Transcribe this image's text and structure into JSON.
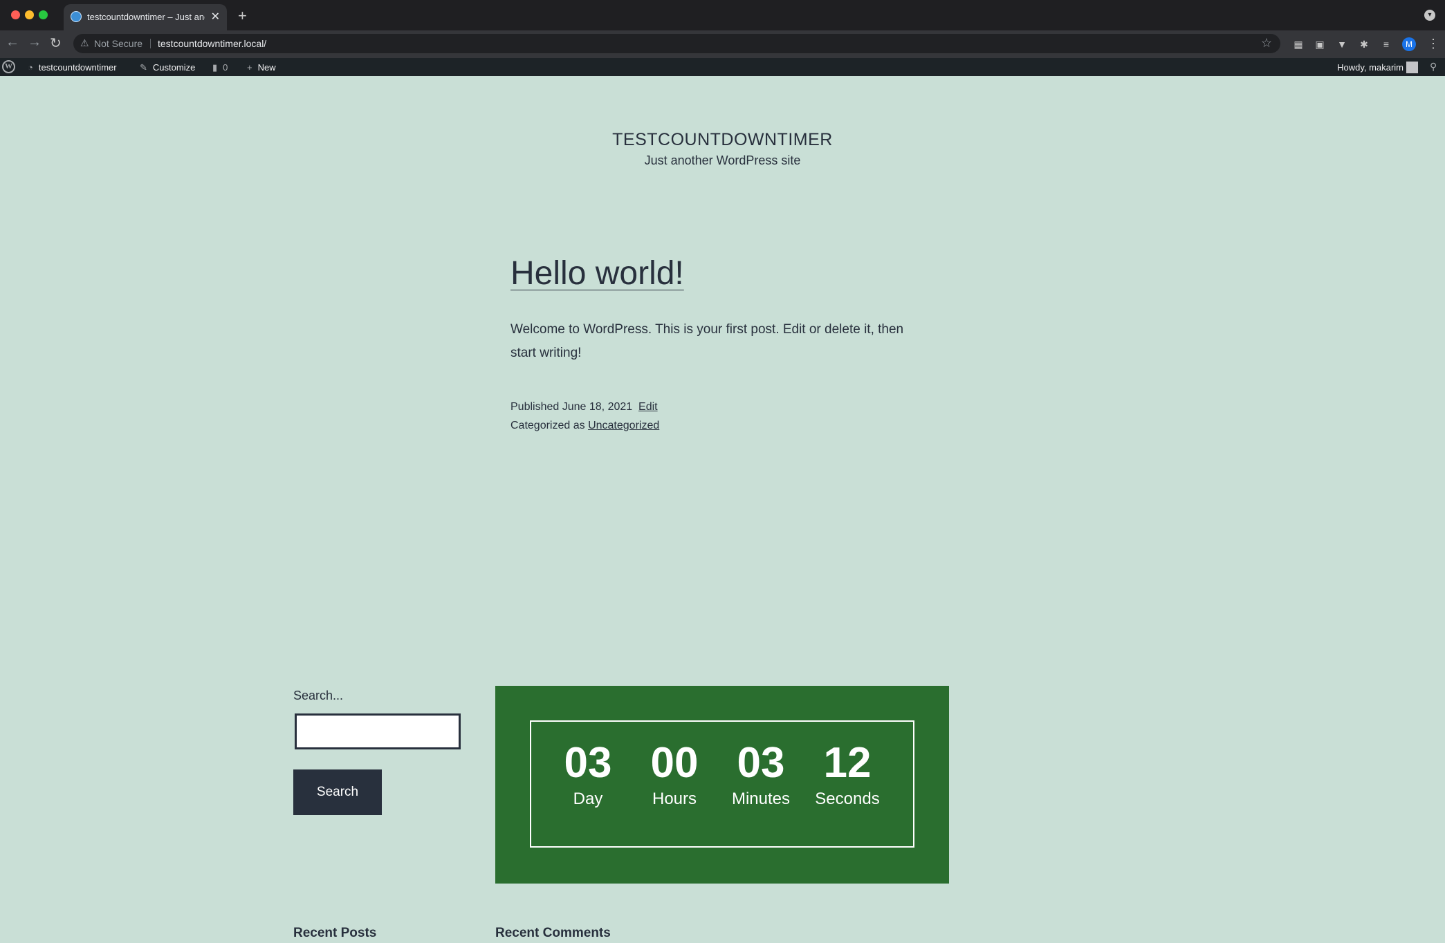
{
  "browser": {
    "tab_title": "testcountdowntimer – Just another WordPress site",
    "security_label": "Not Secure",
    "url": "testcountdowntimer.local/",
    "profile_initial": "M"
  },
  "admin_bar": {
    "site_name": "testcountdowntimer",
    "customize": "Customize",
    "comments_count": "0",
    "new_label": "New",
    "greeting": "Howdy, makarim"
  },
  "site": {
    "title": "TESTCOUNTDOWNTIMER",
    "description": "Just another WordPress site"
  },
  "post": {
    "title": "Hello world!",
    "body": "Welcome to WordPress. This is your first post. Edit or delete it, then start writing!",
    "published_prefix": "Published",
    "published_date": "June 18, 2021",
    "edit_label": "Edit",
    "categorized_prefix": "Categorized as",
    "category": "Uncategorized"
  },
  "search_widget": {
    "label": "Search...",
    "value": "",
    "button_label": "Search"
  },
  "countdown": {
    "colors": {
      "background": "#2a6e2f",
      "text": "#ffffff"
    },
    "units": [
      {
        "value": "03",
        "label": "Day"
      },
      {
        "value": "00",
        "label": "Hours"
      },
      {
        "value": "03",
        "label": "Minutes"
      },
      {
        "value": "12",
        "label": "Seconds"
      }
    ]
  },
  "widgets": {
    "recent_posts": "Recent Posts",
    "recent_comments": "Recent Comments"
  }
}
